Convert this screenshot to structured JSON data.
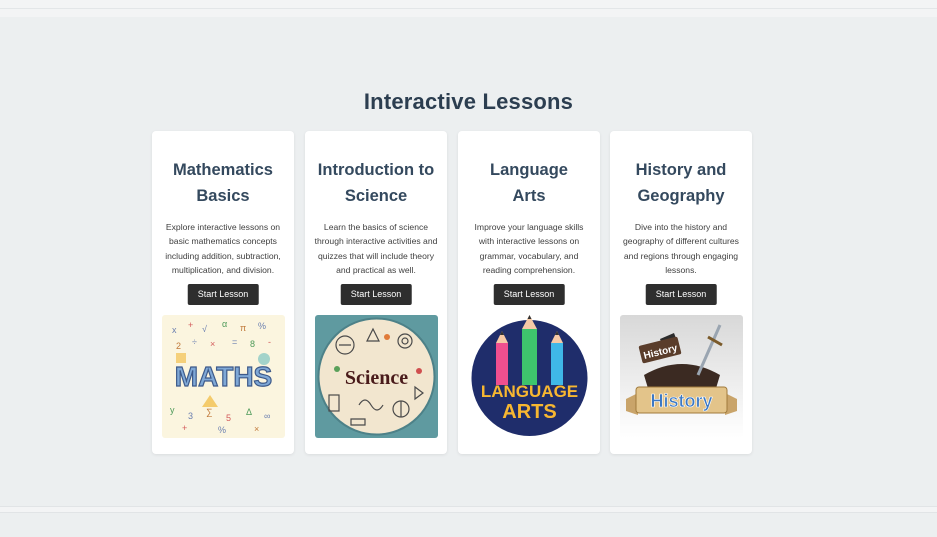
{
  "section": {
    "title": "Interactive Lessons"
  },
  "lessons": [
    {
      "title_line1": "Mathematics",
      "title_line2": "Basics",
      "description": "Explore interactive lessons on basic mathematics concepts including addition, subtraction, multiplication, and division.",
      "button_label": "Start Lesson",
      "image_text": "MATHS"
    },
    {
      "title_line1": "Introduction to",
      "title_line2": "Science",
      "description": "Learn the basics of science through interactive activities and quizzes that will include theory and practical as well.",
      "button_label": "Start Lesson",
      "image_text": "Science"
    },
    {
      "title_line1": "Language",
      "title_line2": "Arts",
      "description": "Improve your language skills with interactive lessons on grammar, vocabulary, and reading comprehension.",
      "button_label": "Start Lesson",
      "image_text_line1": "LANGUAGE",
      "image_text_line2": "ARTS"
    },
    {
      "title_line1": "History and",
      "title_line2": "Geography",
      "description": "Dive into the history and geography of different cultures and regions through engaging lessons.",
      "button_label": "Start Lesson",
      "image_text": "History",
      "image_subtext": "History"
    }
  ],
  "colors": {
    "background": "#eceff0",
    "card": "#ffffff",
    "heading": "#2c3e50",
    "button": "#2e2e2e"
  }
}
